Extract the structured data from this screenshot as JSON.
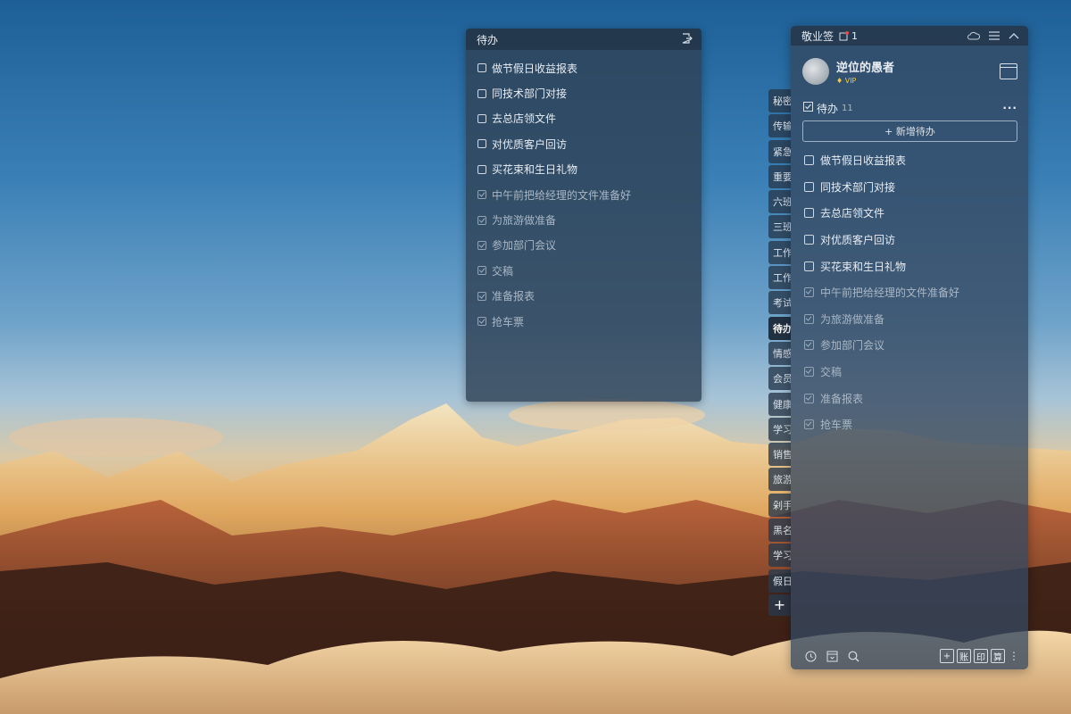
{
  "float_note": {
    "title": "待办",
    "tasks": [
      {
        "label": "做节假日收益报表",
        "done": false
      },
      {
        "label": "同技术部门对接",
        "done": false
      },
      {
        "label": "去总店领文件",
        "done": false
      },
      {
        "label": "对优质客户回访",
        "done": false
      },
      {
        "label": "买花束和生日礼物",
        "done": false
      },
      {
        "label": "中午前把给经理的文件准备好",
        "done": true
      },
      {
        "label": "为旅游做准备",
        "done": true
      },
      {
        "label": "参加部门会议",
        "done": true
      },
      {
        "label": "交稿",
        "done": true
      },
      {
        "label": "准备报表",
        "done": true
      },
      {
        "label": "抢车票",
        "done": true
      }
    ]
  },
  "side_tabs": [
    "秘密",
    "传输",
    "紧急",
    "重要",
    "六班",
    "三班",
    "工作",
    "工作",
    "考试",
    "待办",
    "情感",
    "会员",
    "健康",
    "学习",
    "销售",
    "旅游",
    "剁手",
    "黑名",
    "学习",
    "假日"
  ],
  "active_tab_index": 9,
  "panel": {
    "app_name": "敬业签",
    "notification_count": "1",
    "user": {
      "name": "逆位的愚者",
      "badge": "VIP"
    },
    "section": {
      "title": "待办",
      "count": "11"
    },
    "add_button_label": "+ 新增待办",
    "tasks": [
      {
        "label": "做节假日收益报表",
        "done": false
      },
      {
        "label": "同技术部门对接",
        "done": false
      },
      {
        "label": "去总店领文件",
        "done": false
      },
      {
        "label": "对优质客户回访",
        "done": false
      },
      {
        "label": "买花束和生日礼物",
        "done": false
      },
      {
        "label": "中午前把给经理的文件准备好",
        "done": true
      },
      {
        "label": "为旅游做准备",
        "done": true
      },
      {
        "label": "参加部门会议",
        "done": true
      },
      {
        "label": "交稿",
        "done": true
      },
      {
        "label": "准备报表",
        "done": true
      },
      {
        "label": "抢车票",
        "done": true
      }
    ],
    "footer_buttons": [
      "+",
      "账",
      "印",
      "算"
    ]
  },
  "icons": {
    "float_exit": "exit-icon",
    "bell": "bell-icon",
    "cloud": "cloud-icon",
    "menu": "menu-icon",
    "collapse": "chevron-up-icon",
    "calendar": "calendar-icon",
    "clock": "clock-icon",
    "archive": "archive-icon",
    "search": "search-icon"
  },
  "colors": {
    "vip_gold": "#f3c93b",
    "panel_bg": "#344860",
    "notification_red": "#e54b4b"
  }
}
